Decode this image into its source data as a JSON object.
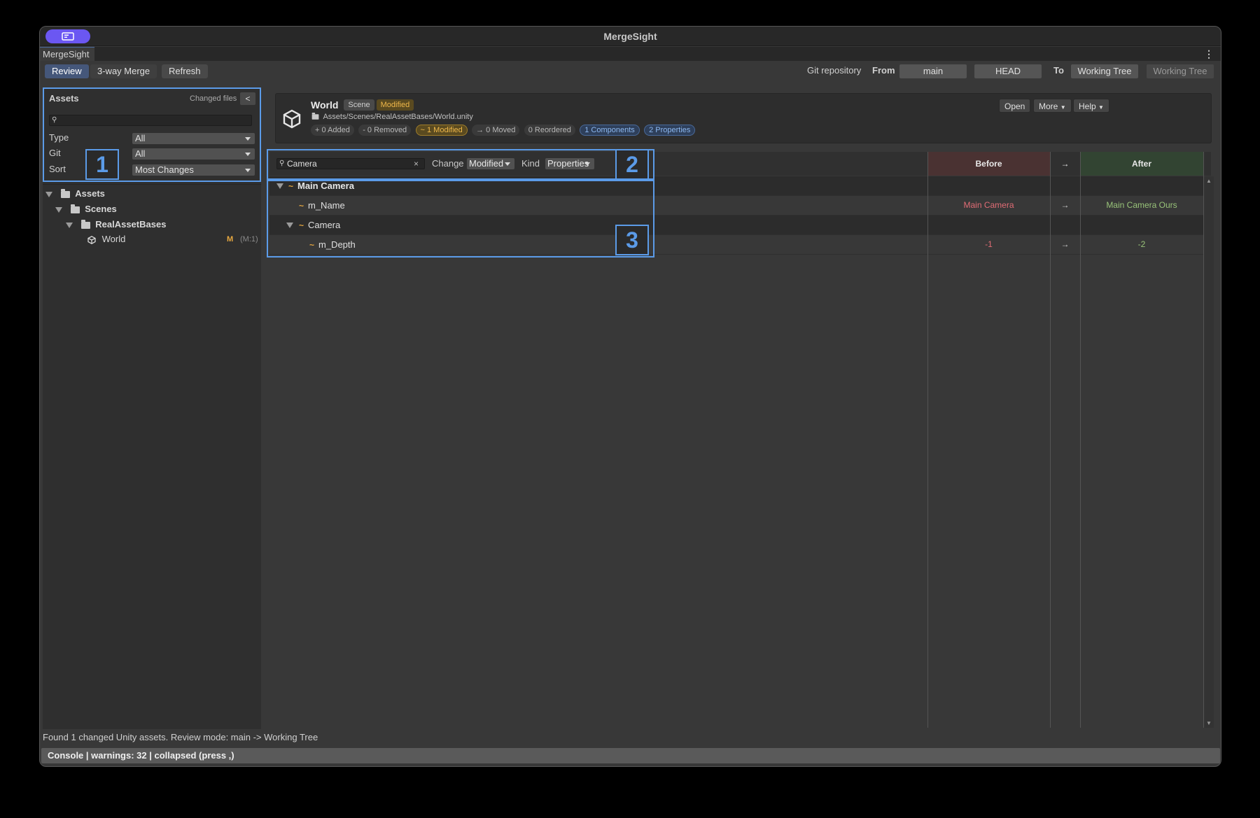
{
  "window": {
    "title": "MergeSight",
    "tab": "MergeSight"
  },
  "toolbar": {
    "review": "Review",
    "three_way": "3-way Merge",
    "refresh": "Refresh",
    "git_repo": "Git repository",
    "from_label": "From",
    "from_branch": "main",
    "from_ref": "HEAD",
    "to_label": "To",
    "to_branch": "Working Tree",
    "to_ref": "Working Tree"
  },
  "left": {
    "title": "Assets",
    "changed_files": "Changed files",
    "collapse": "<",
    "filters": [
      {
        "label": "Type",
        "value": "All"
      },
      {
        "label": "Git",
        "value": "All"
      },
      {
        "label": "Sort",
        "value": "Most Changes"
      }
    ],
    "tree": [
      {
        "label": "Assets"
      },
      {
        "label": "Scenes"
      },
      {
        "label": "RealAssetBases"
      },
      {
        "label": "World",
        "badge": "M",
        "count": "(M:1)"
      }
    ]
  },
  "asset": {
    "name": "World",
    "type_tag": "Scene",
    "status_tag": "Modified",
    "path": "Assets/Scenes/RealAssetBases/World.unity",
    "stats": [
      "+ 0 Added",
      "- 0 Removed",
      "~ 1 Modified",
      "→ 0 Moved",
      "0 Reordered",
      "1 Components",
      "2 Properties"
    ],
    "open": "Open",
    "more": "More",
    "help": "Help"
  },
  "filterbar": {
    "search": "Camera",
    "change_label": "Change",
    "change_value": "Modified",
    "kind_label": "Kind",
    "kind_value": "Properties"
  },
  "columns": {
    "before": "Before",
    "arrow": "→",
    "after": "After"
  },
  "rows": [
    {
      "marker": "~",
      "name": "Main Camera",
      "before": "",
      "arrow": "",
      "after": ""
    },
    {
      "marker": "~",
      "name": "m_Name",
      "before": "Main Camera",
      "arrow": "→",
      "after": "Main Camera Ours"
    },
    {
      "marker": "~",
      "name": "Camera",
      "before": "",
      "arrow": "",
      "after": ""
    },
    {
      "marker": "~",
      "name": "m_Depth",
      "before": "-1",
      "arrow": "→",
      "after": "-2"
    }
  ],
  "annotations": [
    "1",
    "2",
    "3"
  ],
  "status": "Found 1 changed Unity assets. Review mode: main -> Working Tree",
  "console": "Console | warnings: 32 | collapsed (press ,)",
  "colors": {
    "accent": "#6b57f2",
    "modified": "#e8a940",
    "before": "#e06c75",
    "after": "#98c379",
    "annotation": "#5b9be8"
  }
}
